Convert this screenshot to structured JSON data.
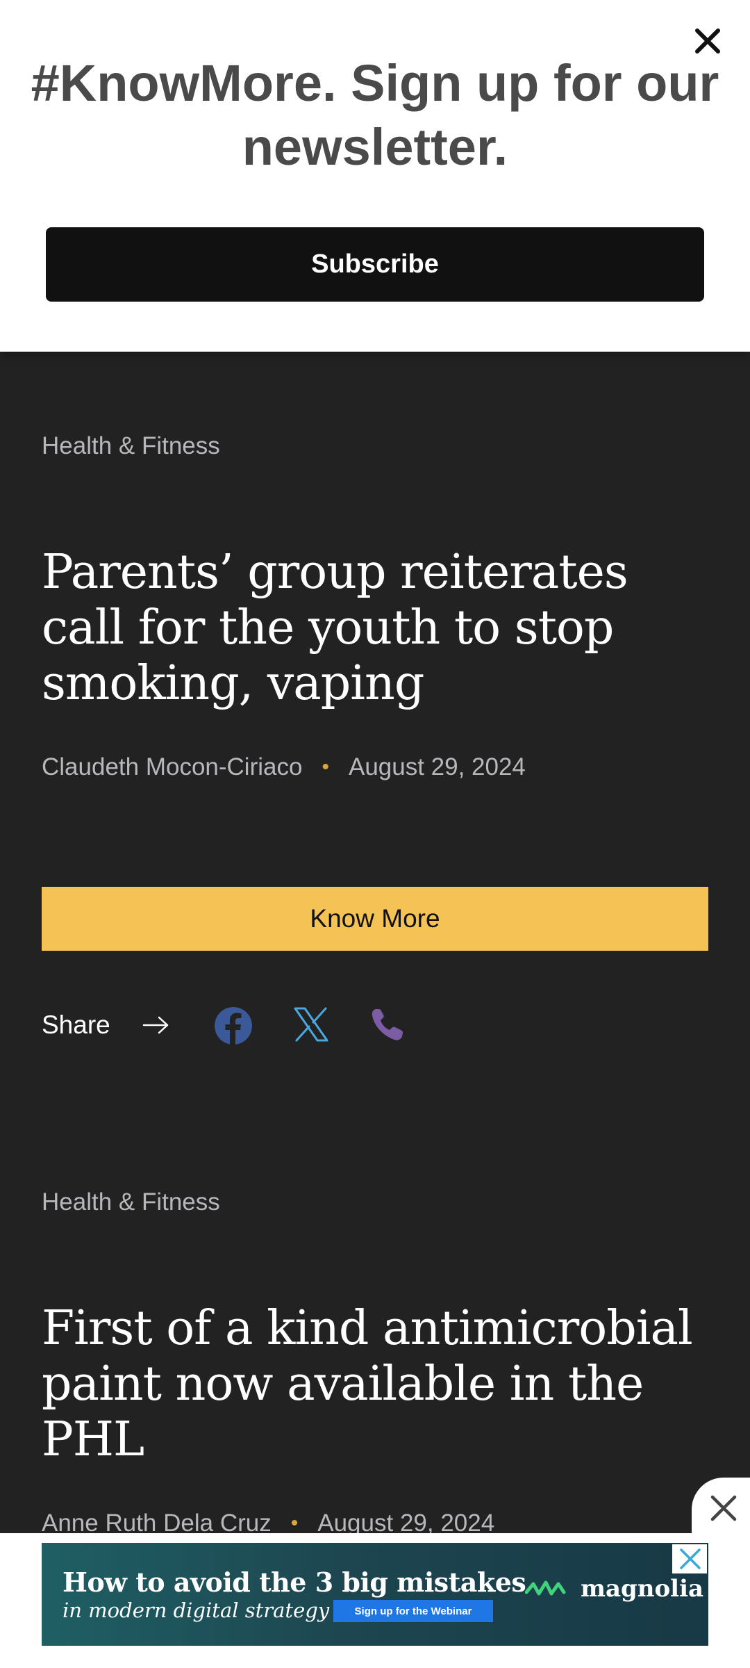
{
  "banner": {
    "title": "#KnowMore. Sign up for our newsletter.",
    "subscribe_label": "Subscribe"
  },
  "articles": [
    {
      "category": "Health & Fitness",
      "title": "Parents’ group reiterates call for the youth to stop smoking, vaping",
      "author": "Claudeth Mocon-Ciriaco",
      "date": "August 29, 2024",
      "cta_label": "Know More",
      "share_label": "Share"
    },
    {
      "category": "Health & Fitness",
      "title": "First of a kind antimicrobial paint now available in the PHL",
      "author": "Anne Ruth Dela Cruz",
      "date": "August 29, 2024"
    }
  ],
  "share_icons": [
    "facebook-icon",
    "x-twitter-icon",
    "viber-phone-icon"
  ],
  "ad": {
    "headline": "How to avoid the 3 big mistakes",
    "subline": "in modern digital strategy",
    "cta": "Sign up for the Webinar",
    "brand": "magnolia"
  },
  "colors": {
    "background": "#222223",
    "accent_button": "#f5c255",
    "facebook": "#3b5998",
    "x": "#4aa8e0",
    "viber": "#7d5ca6"
  }
}
